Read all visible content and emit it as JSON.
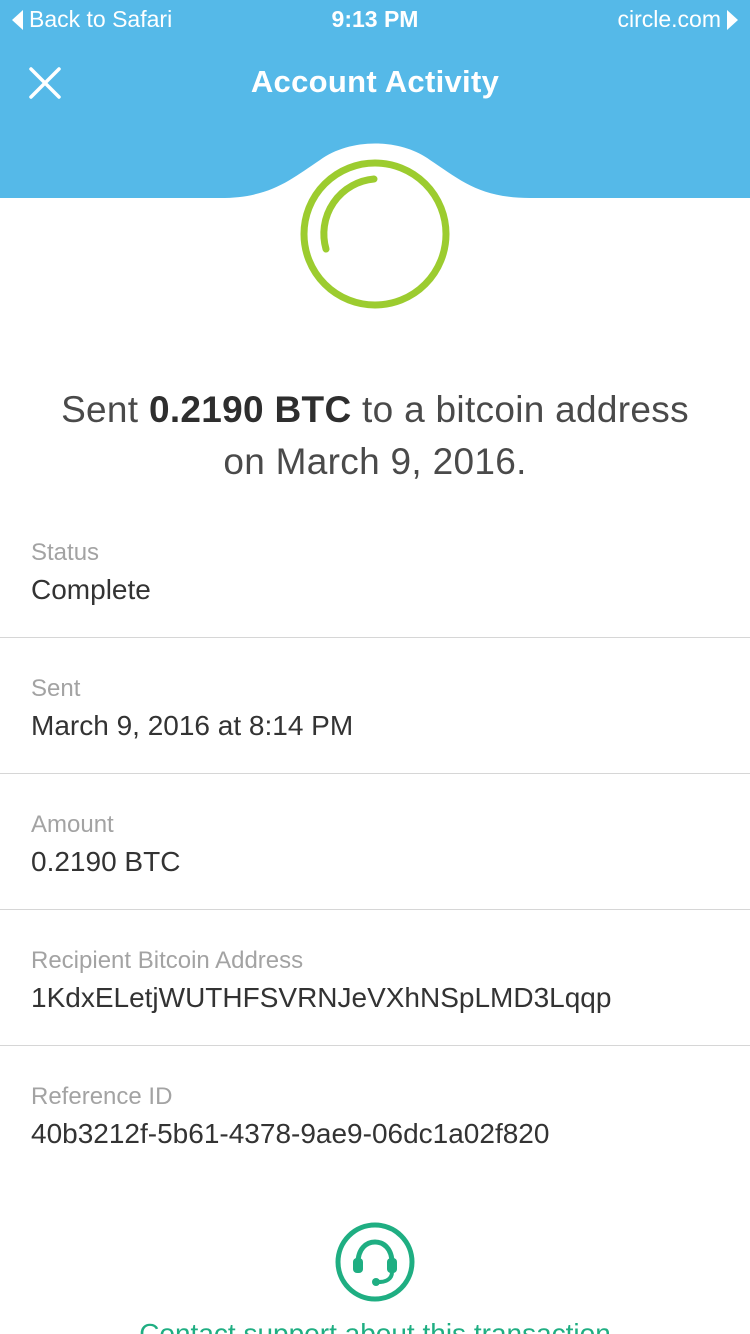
{
  "status_bar": {
    "back_label": "Back to Safari",
    "time": "9:13 PM",
    "domain": "circle.com"
  },
  "header": {
    "title": "Account Activity",
    "close_icon": "close-icon",
    "color": "#55b9e8"
  },
  "status_indicator": {
    "icon": "transaction-status-ring-icon",
    "color": "#9ccc2f"
  },
  "summary": {
    "prefix": "Sent ",
    "amount": "0.2190 BTC",
    "suffix": " to a bitcoin address",
    "date_line": "on March 9, 2016."
  },
  "details": [
    {
      "label": "Status",
      "value": "Complete"
    },
    {
      "label": "Sent",
      "value": "March 9, 2016 at 8:14 PM"
    },
    {
      "label": "Amount",
      "value": "0.2190 BTC"
    },
    {
      "label": "Recipient Bitcoin Address",
      "value": "1KdxELetjWUTHFSVRNJeVXhNSpLMD3Lqqp"
    },
    {
      "label": "Reference ID",
      "value": "40b3212f-5b61-4378-9ae9-06dc1a02f820"
    }
  ],
  "support": {
    "icon": "headset-icon",
    "link_label": "Contact support about this transaction",
    "color": "#1fae82"
  }
}
